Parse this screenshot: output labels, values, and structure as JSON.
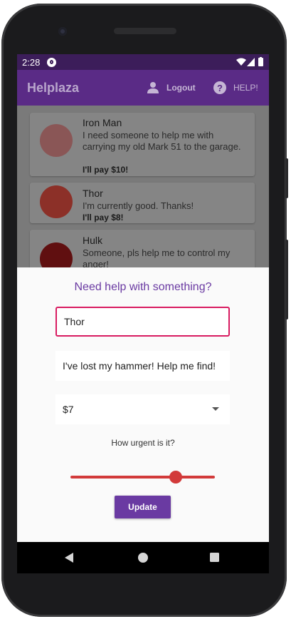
{
  "status_bar": {
    "time": "2:28"
  },
  "app_bar": {
    "title": "Helplaza",
    "logout_label": "Logout",
    "help_label": "HELP!"
  },
  "requests": [
    {
      "name": "Iron Man",
      "message": "I need someone to help me with carrying my old Mark 51 to the garage.",
      "pay": "I'll pay $10!",
      "avatar_color": "#8a5656"
    },
    {
      "name": "Thor",
      "message": "I'm currently good. Thanks!",
      "pay": "I'll pay $8!",
      "avatar_color": "#8c3028"
    },
    {
      "name": "Hulk",
      "message": "Someone, pls help me to control my anger!",
      "pay": "",
      "avatar_color": "#600f10"
    }
  ],
  "form": {
    "heading": "Need help with something?",
    "name_value": "Thor",
    "message_value": "I've lost my hammer! Help me find!",
    "pay_value": "$7",
    "urgency_label": "How urgent is it?",
    "urgency_value": 0.73,
    "submit_label": "Update"
  },
  "colors": {
    "primary": "#5a2b86",
    "status_bar": "#3c1d5a",
    "accent": "#d23a3a",
    "focus_border": "#d81b60",
    "button": "#6a3aa2"
  }
}
